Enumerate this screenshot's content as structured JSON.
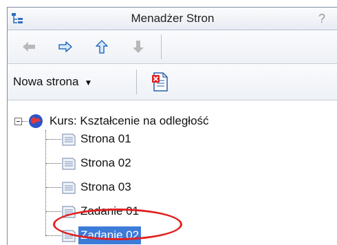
{
  "window": {
    "title": "Menadżer Stron"
  },
  "toolbar": {
    "new_page_label": "Nowa strona"
  },
  "tree": {
    "root_label": "Kurs: Kształcenie na odległość",
    "items": [
      {
        "label": "Strona 01"
      },
      {
        "label": "Strona 02"
      },
      {
        "label": "Strona 03"
      },
      {
        "label": "Zadanie 01"
      },
      {
        "label": "Zadanie 02"
      }
    ],
    "selected_item": "Zadanie 02"
  },
  "colors": {
    "selection": "#3d7bd9",
    "highlight": "#e02020"
  }
}
